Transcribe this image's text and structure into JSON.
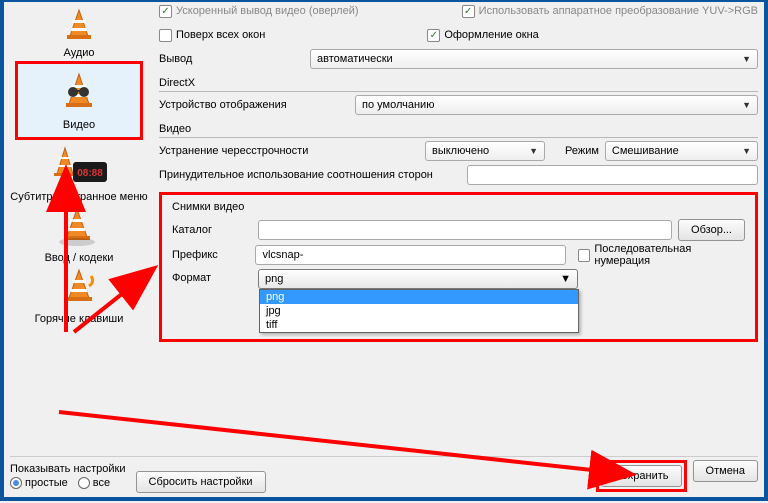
{
  "sidebar": {
    "items": [
      {
        "label": "Аудио"
      },
      {
        "label": "Видео"
      },
      {
        "label": "Субтитры / экранное меню"
      },
      {
        "label": "Ввод / кодеки"
      },
      {
        "label": "Горячие клавиши"
      }
    ]
  },
  "top": {
    "accel_overlay_label": "Ускоренный вывод видео (оверлей)",
    "hw_conv_label": "Использовать аппаратное преобразование YUV->RGB",
    "always_on_top_label": "Поверх всех окон",
    "window_decorations_label": "Оформление окна",
    "output_label": "Вывод",
    "output_value": "автоматически"
  },
  "directx": {
    "header": "DirectX",
    "display_device_label": "Устройство отображения",
    "display_device_value": "по умолчанию"
  },
  "video": {
    "header": "Видео",
    "deinterlace_label": "Устранение чересстрочности",
    "deinterlace_value": "выключено",
    "mode_label": "Режим",
    "mode_value": "Смешивание",
    "force_aspect_label": "Принудительное использование соотношения сторон",
    "force_aspect_value": ""
  },
  "snap": {
    "header": "Снимки видео",
    "dir_label": "Каталог",
    "dir_value": "",
    "browse_label": "Обзор...",
    "prefix_label": "Префикс",
    "prefix_value": "vlcsnap-",
    "seq_label": "Последовательная нумерация",
    "format_label": "Формат",
    "format_value": "png",
    "format_options": [
      "png",
      "jpg",
      "tiff"
    ]
  },
  "footer": {
    "show_settings_label": "Показывать настройки",
    "simple_label": "простые",
    "all_label": "все",
    "reset_label": "Сбросить настройки",
    "save_label": "Сохранить",
    "cancel_label": "Отмена"
  }
}
